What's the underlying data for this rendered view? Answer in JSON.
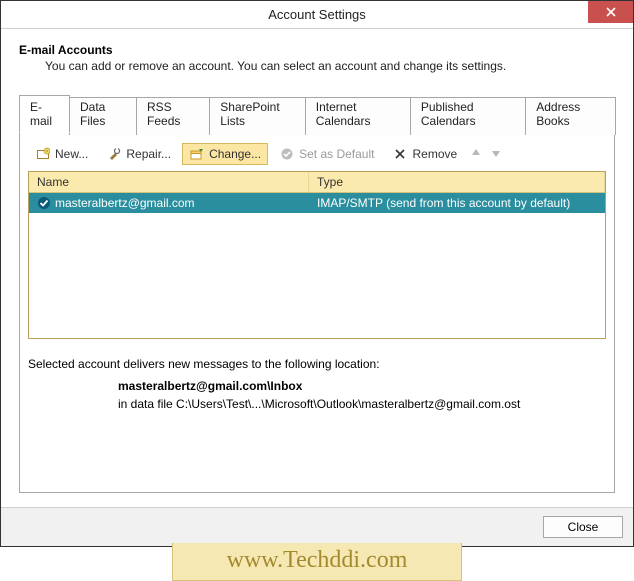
{
  "titlebar": {
    "title": "Account Settings"
  },
  "header": {
    "heading": "E-mail Accounts",
    "subtext": "You can add or remove an account. You can select an account and change its settings."
  },
  "tabs": [
    {
      "label": "E-mail",
      "active": true
    },
    {
      "label": "Data Files"
    },
    {
      "label": "RSS Feeds"
    },
    {
      "label": "SharePoint Lists"
    },
    {
      "label": "Internet Calendars"
    },
    {
      "label": "Published Calendars"
    },
    {
      "label": "Address Books"
    }
  ],
  "toolbar": {
    "new": "New...",
    "repair": "Repair...",
    "change": "Change...",
    "set_default": "Set as Default",
    "remove": "Remove"
  },
  "table": {
    "columns": {
      "name": "Name",
      "type": "Type"
    },
    "rows": [
      {
        "name": "masteralbertz@gmail.com",
        "type": "IMAP/SMTP (send from this account by default)"
      }
    ]
  },
  "location": {
    "label": "Selected account delivers new messages to the following location:",
    "path": "masteralbertz@gmail.com\\Inbox",
    "file": "in data file C:\\Users\\Test\\...\\Microsoft\\Outlook\\masteralbertz@gmail.com.ost"
  },
  "footer": {
    "close": "Close"
  },
  "watermark": "www.Techddi.com"
}
